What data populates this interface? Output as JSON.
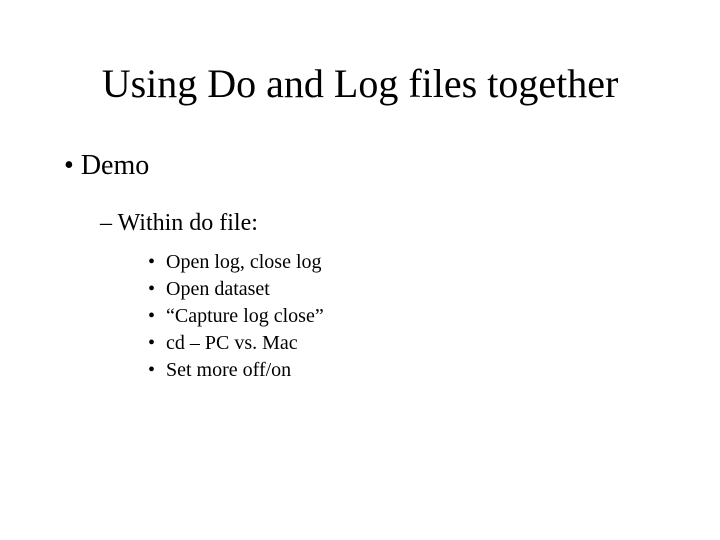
{
  "title": "Using Do and Log files together",
  "level1": {
    "item0": "Demo"
  },
  "level2": {
    "item0": "Within do file:"
  },
  "level3": {
    "item0": "Open log, close log",
    "item1": "Open dataset",
    "item2": "“Capture log close”",
    "item3": "cd – PC vs. Mac",
    "item4": "Set more off/on"
  }
}
